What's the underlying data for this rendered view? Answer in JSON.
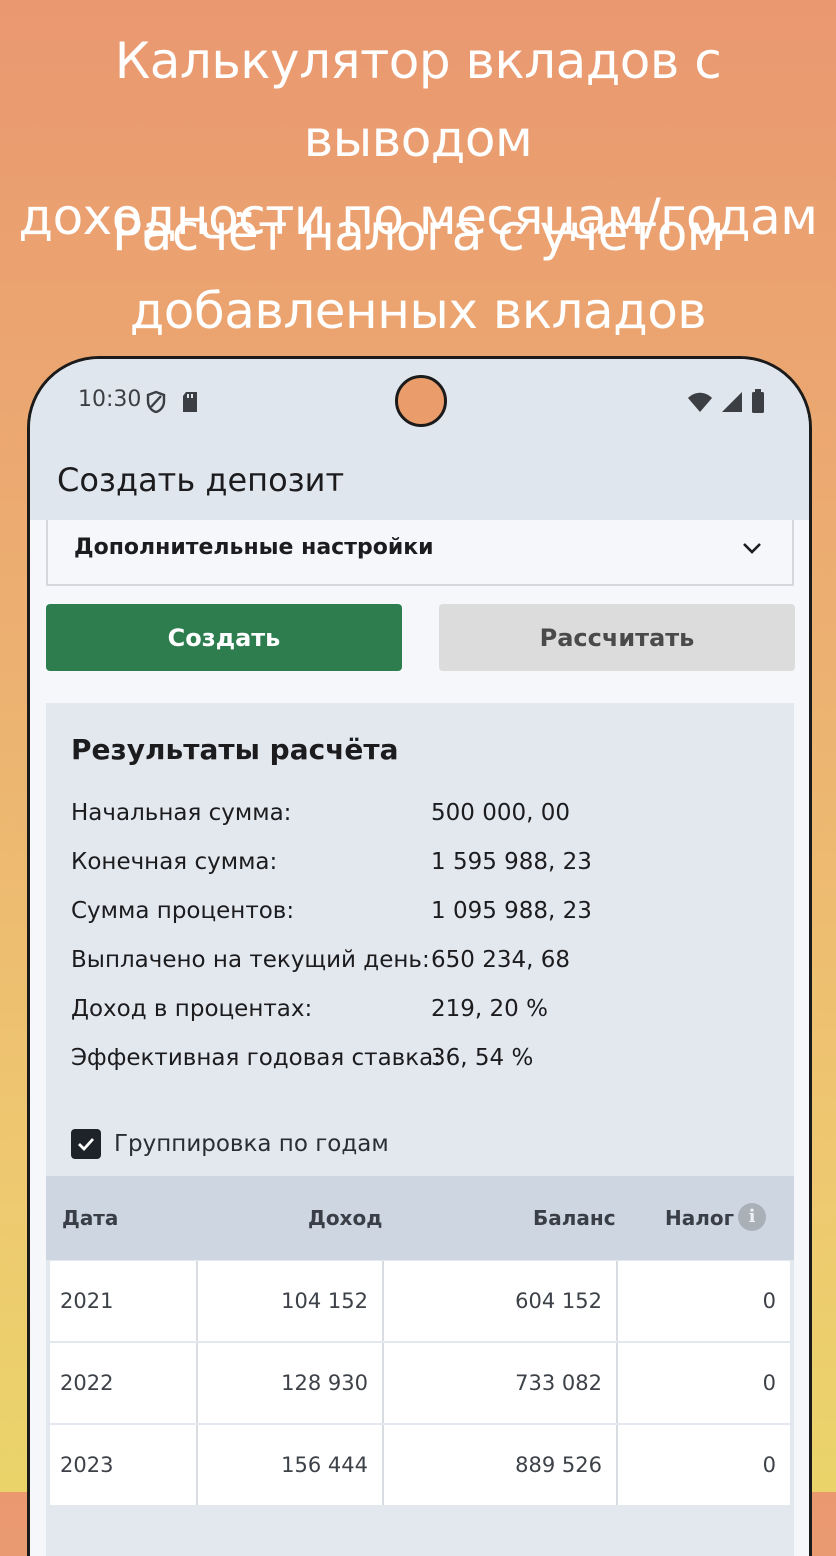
{
  "promo": {
    "line1a": "Калькулятор вкладов с выводом",
    "line1b": "доходности по месяцам/годам",
    "line2a": "Расчёт налога с учетом",
    "line2b": "добавленных вкладов"
  },
  "status_bar": {
    "time": "10:30",
    "icons": [
      "shield-icon",
      "sd-card-icon",
      "wifi-icon",
      "signal-icon",
      "battery-icon"
    ]
  },
  "app_bar": {
    "title": "Создать депозит"
  },
  "advanced_settings": {
    "label": "Дополнительные настройки",
    "icon": "chevron-down-icon"
  },
  "buttons": {
    "create": "Создать",
    "calculate": "Рассчитать"
  },
  "results": {
    "title": "Результаты расчёта",
    "rows": [
      {
        "label": "Начальная сумма:",
        "value": "500 000, 00"
      },
      {
        "label": "Конечная сумма:",
        "value": "1 595 988, 23"
      },
      {
        "label": "Сумма процентов:",
        "value": "1 095 988, 23"
      },
      {
        "label": "Выплачено на текущий день:",
        "value": "650 234, 68"
      },
      {
        "label": "Доход в процентах:",
        "value": "219, 20 %"
      },
      {
        "label": "Эффективная годовая ставка:",
        "value": "36, 54 %"
      }
    ],
    "group_by_years": {
      "label": "Группировка по годам",
      "checked": true
    }
  },
  "table": {
    "headers": {
      "date": "Дата",
      "income": "Доход",
      "balance": "Баланс",
      "tax": "Налог",
      "info": "i"
    },
    "rows": [
      {
        "date": "2021",
        "income": "104 152",
        "balance": "604 152",
        "tax": "0"
      },
      {
        "date": "2022",
        "income": "128 930",
        "balance": "733 082",
        "tax": "0"
      },
      {
        "date": "2023",
        "income": "156 444",
        "balance": "889 526",
        "tax": "0"
      }
    ]
  },
  "colors": {
    "primary_button": "#2e7d4f",
    "secondary_button": "#dcdcdc",
    "appbar": "#e0e6ee",
    "results_bg": "#e3e8ef"
  }
}
